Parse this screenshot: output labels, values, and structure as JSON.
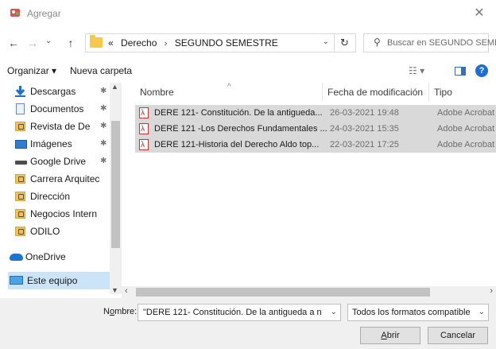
{
  "window": {
    "title": "Agregar",
    "close_glyph": "✕"
  },
  "nav": {
    "back_glyph": "←",
    "forward_glyph": "→",
    "recent_glyph": "⌄",
    "up_glyph": "↑",
    "breadcrumb_prefix": "«",
    "breadcrumb": [
      "Derecho",
      "SEGUNDO SEMESTRE"
    ],
    "breadcrumb_sep": "›",
    "refresh_glyph": "↻",
    "search_placeholder": "Buscar en SEGUNDO SEMES..."
  },
  "toolbar": {
    "organize_label": "Organizar ▾",
    "new_folder_label": "Nueva carpeta",
    "view_glyph": "☷ ▾",
    "help_glyph": "?"
  },
  "sidebar": {
    "items": [
      {
        "label": "Descargas",
        "icon": "download-icon",
        "pinned": true
      },
      {
        "label": "Documentos",
        "icon": "documents-icon",
        "pinned": true
      },
      {
        "label": "Revista de De",
        "icon": "folder-icon",
        "pinned": true
      },
      {
        "label": "Imágenes",
        "icon": "pictures-icon",
        "pinned": true
      },
      {
        "label": "Google Drive",
        "icon": "drive-icon",
        "pinned": true
      },
      {
        "label": "Carrera Arquitec",
        "icon": "folder-icon",
        "pinned": false
      },
      {
        "label": "Dirección",
        "icon": "folder-icon",
        "pinned": false
      },
      {
        "label": "Negocios Intern",
        "icon": "folder-icon",
        "pinned": false
      },
      {
        "label": "ODILO",
        "icon": "folder-icon",
        "pinned": false
      },
      {
        "label": "OneDrive",
        "icon": "onedrive-icon",
        "pinned": false
      },
      {
        "label": "Este equipo",
        "icon": "this-pc-icon",
        "pinned": false,
        "selected": true
      }
    ],
    "pin_glyph": "✱"
  },
  "columns": {
    "name": "Nombre",
    "modified": "Fecha de modificación",
    "type": "Tipo"
  },
  "files": [
    {
      "name": "DERE 121- Constitución. De la antigueda...",
      "modified": "26-03-2021 19:48",
      "type": "Adobe Acrobat"
    },
    {
      "name": "DERE 121 -Los Derechos Fundamentales ...",
      "modified": "24-03-2021 15:35",
      "type": "Adobe Acrobat"
    },
    {
      "name": "DERE 121-Historia del Derecho  Aldo top...",
      "modified": "22-03-2021 17:25",
      "type": "Adobe Acrobat"
    }
  ],
  "footer": {
    "filename_label_pre": "N",
    "filename_label_u": "o",
    "filename_label_post": "mbre:",
    "filename_value": "\"DERE 121- Constitución. De la antigueda a n",
    "filter_value": "Todos los formatos compatible",
    "open_u": "A",
    "open_rest": "brir",
    "cancel_label": "Cancelar"
  }
}
